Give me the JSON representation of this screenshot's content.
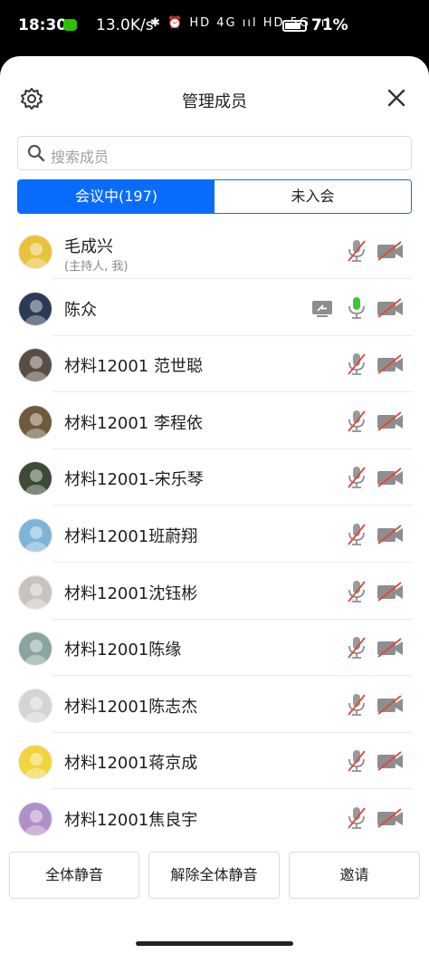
{
  "status": {
    "time": "18:30",
    "speed": "13.0K/s",
    "icons": "✱ ⏰ HD 4G ııl HD 5G ııl",
    "battery": "71%"
  },
  "header": {
    "title": "管理成员"
  },
  "search": {
    "placeholder": "搜索成员"
  },
  "tabs": [
    {
      "label": "会议中(197)"
    },
    {
      "label": "未入会"
    }
  ],
  "members": [
    {
      "name": "毛成兴",
      "sub": "(主持人, 我)",
      "mic": "muted",
      "cam": "off",
      "share": false,
      "avatar": "#e8c23a"
    },
    {
      "name": "陈众",
      "sub": "",
      "mic": "active",
      "cam": "off",
      "share": true,
      "avatar": "#2b3a55"
    },
    {
      "name": "材料12001 范世聪",
      "sub": "",
      "mic": "muted",
      "cam": "off",
      "share": false,
      "avatar": "#5a4e44"
    },
    {
      "name": "材料12001 李程依",
      "sub": "",
      "mic": "muted",
      "cam": "off",
      "share": false,
      "avatar": "#6e5a3c"
    },
    {
      "name": "材料12001-宋乐琴",
      "sub": "",
      "mic": "muted",
      "cam": "off",
      "share": false,
      "avatar": "#3c4a36"
    },
    {
      "name": "材料12001班蔚翔",
      "sub": "",
      "mic": "muted",
      "cam": "off",
      "share": false,
      "avatar": "#7fb3d8"
    },
    {
      "name": "材料12001沈钰彬",
      "sub": "",
      "mic": "muted",
      "cam": "off",
      "share": false,
      "avatar": "#c9c3c0"
    },
    {
      "name": "材料12001陈缘",
      "sub": "",
      "mic": "muted",
      "cam": "off",
      "share": false,
      "avatar": "#8aa5a0"
    },
    {
      "name": "材料12001陈志杰",
      "sub": "",
      "mic": "muted",
      "cam": "off",
      "share": false,
      "avatar": "#d4d4d4"
    },
    {
      "name": "材料12001蒋京成",
      "sub": "",
      "mic": "muted",
      "cam": "off",
      "share": false,
      "avatar": "#f2d43c"
    },
    {
      "name": "材料12001焦良宇",
      "sub": "",
      "mic": "muted",
      "cam": "off",
      "share": false,
      "avatar": "#b190c8"
    }
  ],
  "actions": {
    "mute_all": "全体静音",
    "unmute_all": "解除全体静音",
    "invite": "邀请"
  },
  "colors": {
    "accent": "#0a6cff",
    "mic_active": "#3cc43c",
    "mute_slash": "#e0483a",
    "icon_gray": "#8e8e8e"
  }
}
